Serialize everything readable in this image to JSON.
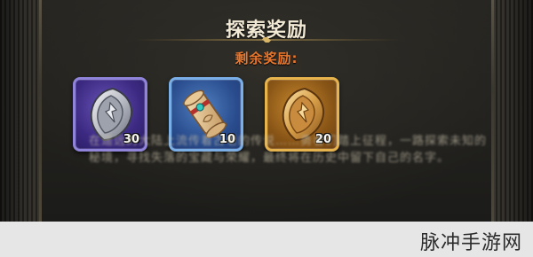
{
  "panel": {
    "title": "探索奖励",
    "subtitle": "剩余奖励:"
  },
  "rewards": [
    {
      "icon": "silver-crest-icon",
      "count": "30",
      "frame_color": "#8f84d9"
    },
    {
      "icon": "scroll-icon",
      "count": "10",
      "frame_color": "#7aaee6"
    },
    {
      "icon": "gold-crest-icon",
      "count": "20",
      "frame_color": "#e6b34c"
    }
  ],
  "description": "在遥远的大陆上流传着古老的传说……勇者们踏上征程，一路探索未知的秘境，寻找失落的宝藏与荣耀，最终将在历史中留下自己的名字。",
  "watermark": {
    "text": "脉冲手游网"
  },
  "colors": {
    "title": "#f3ead6",
    "subtitle": "#e8762c",
    "accent_gold": "#b0893f"
  }
}
